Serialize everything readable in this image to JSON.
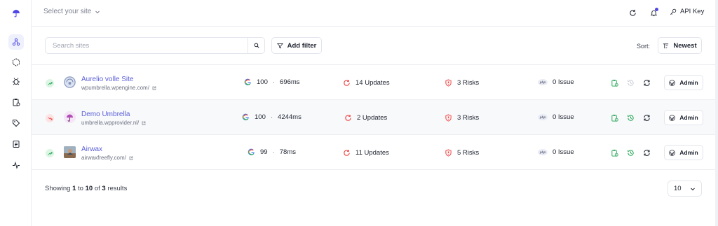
{
  "topbar": {
    "site_select_label": "Select your site",
    "api_key_label": "API Key"
  },
  "toolbar": {
    "search_placeholder": "Search sites",
    "filter_label": "Add filter",
    "sort_label": "Sort:",
    "sort_value": "Newest"
  },
  "colors": {
    "accent": "#5b5fd6",
    "success": "#22c55e",
    "danger": "#ef4444",
    "notification": "#4f46e5"
  },
  "rows": [
    {
      "name": "Aurelio volle Site",
      "url": "wpumbrella.wpengine.com/",
      "status": "up",
      "score": "100",
      "time": "696ms",
      "updates": "14 Updates",
      "risks": "3 Risks",
      "issues": "0 Issue",
      "admin_label": "Admin"
    },
    {
      "name": "Demo Umbrella",
      "url": "umbrella.wpprovider.nl/",
      "status": "down",
      "score": "100",
      "time": "4244ms",
      "updates": "2 Updates",
      "risks": "3 Risks",
      "issues": "0 Issue",
      "admin_label": "Admin"
    },
    {
      "name": "Airwax",
      "url": "airwaxfreefly.com/",
      "status": "up",
      "score": "99",
      "time": "78ms",
      "updates": "11 Updates",
      "risks": "5 Risks",
      "issues": "0 Issue",
      "admin_label": "Admin"
    }
  ],
  "footer": {
    "showing_prefix": "Showing",
    "from": "1",
    "to_word": "to",
    "to": "10",
    "of_word": "of",
    "total": "3",
    "results_word": "results",
    "page_size": "10"
  }
}
